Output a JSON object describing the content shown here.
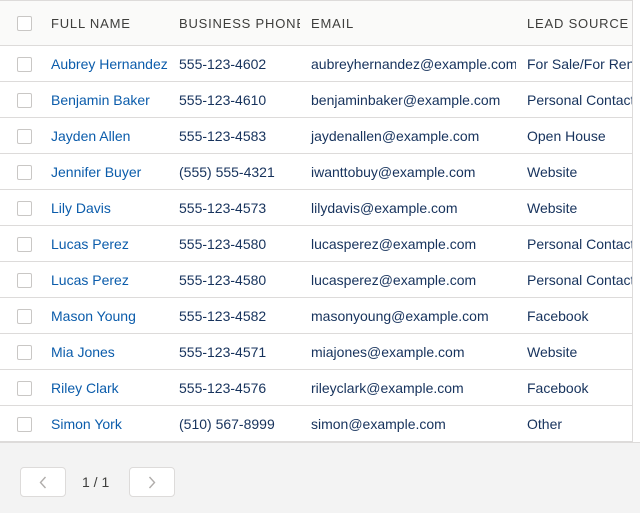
{
  "table": {
    "columns": [
      "FULL NAME",
      "BUSINESS PHONE",
      "EMAIL",
      "LEAD SOURCE"
    ],
    "rows": [
      {
        "full_name": "Aubrey Hernandez",
        "business_phone": "555-123-4602",
        "email": "aubreyhernandez@example.com",
        "lead_source": "For Sale/For Rent"
      },
      {
        "full_name": "Benjamin Baker",
        "business_phone": "555-123-4610",
        "email": "benjaminbaker@example.com",
        "lead_source": "Personal Contacts"
      },
      {
        "full_name": "Jayden Allen",
        "business_phone": "555-123-4583",
        "email": "jaydenallen@example.com",
        "lead_source": "Open House"
      },
      {
        "full_name": "Jennifer Buyer",
        "business_phone": "(555) 555-4321",
        "email": "iwanttobuy@example.com",
        "lead_source": "Website"
      },
      {
        "full_name": "Lily Davis",
        "business_phone": "555-123-4573",
        "email": "lilydavis@example.com",
        "lead_source": "Website"
      },
      {
        "full_name": "Lucas Perez",
        "business_phone": "555-123-4580",
        "email": "lucasperez@example.com",
        "lead_source": "Personal Contacts"
      },
      {
        "full_name": "Lucas Perez",
        "business_phone": "555-123-4580",
        "email": "lucasperez@example.com",
        "lead_source": "Personal Contacts"
      },
      {
        "full_name": "Mason Young",
        "business_phone": "555-123-4582",
        "email": "masonyoung@example.com",
        "lead_source": "Facebook"
      },
      {
        "full_name": "Mia Jones",
        "business_phone": "555-123-4571",
        "email": "miajones@example.com",
        "lead_source": "Website"
      },
      {
        "full_name": "Riley Clark",
        "business_phone": "555-123-4576",
        "email": "rileyclark@example.com",
        "lead_source": "Facebook"
      },
      {
        "full_name": "Simon York",
        "business_phone": "(510) 567-8999",
        "email": "simon@example.com",
        "lead_source": "Other"
      }
    ]
  },
  "pagination": {
    "indicator": "1 / 1",
    "prev_icon": "chevron-left-icon",
    "next_icon": "chevron-right-icon"
  },
  "colors": {
    "link": "#0b5cab",
    "text": "#16325c",
    "border": "#dddbda",
    "footer_bg": "#f3f3f3"
  }
}
